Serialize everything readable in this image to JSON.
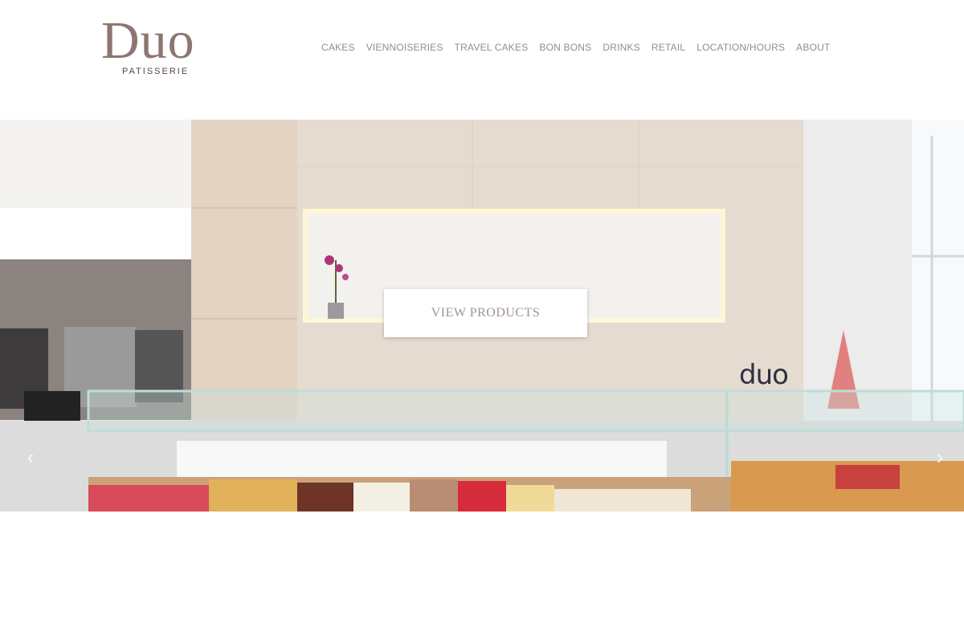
{
  "brand": {
    "name": "Duo",
    "subtitle": "PATISSERIE",
    "logo_color": "#8c7671"
  },
  "nav": {
    "items": [
      {
        "label": "CAKES"
      },
      {
        "label": "VIENNOISERIES"
      },
      {
        "label": "TRAVEL CAKES"
      },
      {
        "label": "BON BONS"
      },
      {
        "label": "DRINKS"
      },
      {
        "label": "RETAIL"
      },
      {
        "label": "LOCATION/HOURS"
      },
      {
        "label": "ABOUT"
      }
    ],
    "text_color": "#9a8a86"
  },
  "hero": {
    "cta_label": "VIEW PRODUCTS",
    "sign_text": "duo",
    "image_subject": "patisserie-display-counter"
  }
}
